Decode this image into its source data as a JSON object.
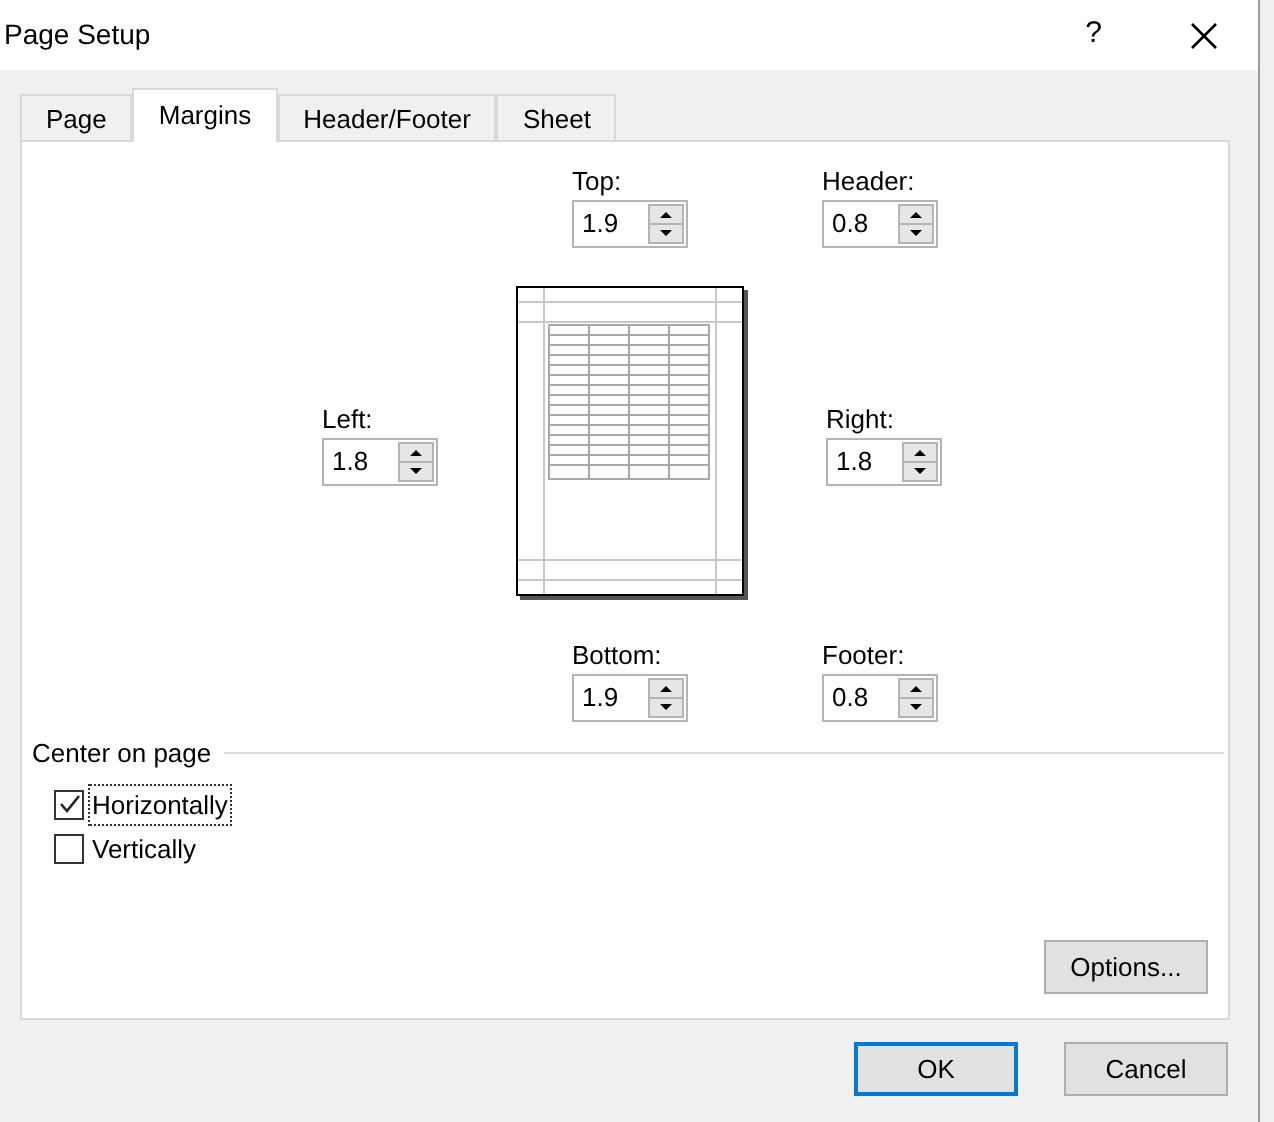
{
  "window": {
    "title": "Page Setup",
    "help": "?"
  },
  "tabs": [
    {
      "label": "Page",
      "selected": false
    },
    {
      "label": "Margins",
      "selected": true
    },
    {
      "label": "Header/Footer",
      "selected": false
    },
    {
      "label": "Sheet",
      "selected": false
    }
  ],
  "margins": {
    "top": {
      "label": "Top:",
      "value": "1.9"
    },
    "header": {
      "label": "Header:",
      "value": "0.8"
    },
    "left": {
      "label": "Left:",
      "value": "1.8"
    },
    "right": {
      "label": "Right:",
      "value": "1.8"
    },
    "bottom": {
      "label": "Bottom:",
      "value": "1.9"
    },
    "footer": {
      "label": "Footer:",
      "value": "0.8"
    }
  },
  "center_on_page": {
    "title": "Center on page",
    "options": [
      {
        "label": "Horizontally",
        "checked": true,
        "focused": true
      },
      {
        "label": "Vertically",
        "checked": false,
        "focused": false
      }
    ]
  },
  "options_button": {
    "label": "Options..."
  },
  "buttons": [
    {
      "label": "OK",
      "default": true
    },
    {
      "label": "Cancel",
      "default": false
    }
  ]
}
